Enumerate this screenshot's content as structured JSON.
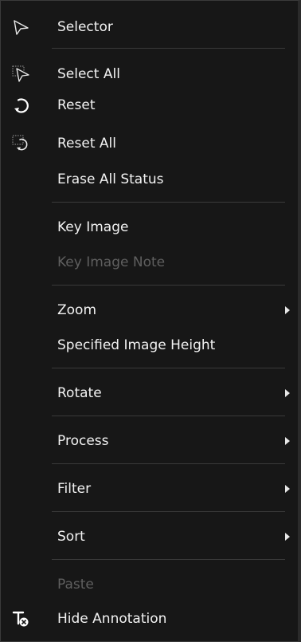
{
  "menu": {
    "items": [
      {
        "label": "Selector",
        "icon": "cursor-arrow-icon",
        "enabled": true,
        "submenu": false
      },
      {
        "label": "Select All",
        "icon": "select-all-icon",
        "enabled": true,
        "submenu": false
      },
      {
        "label": "Reset",
        "icon": "reset-icon",
        "enabled": true,
        "submenu": false
      },
      {
        "label": "Reset All",
        "icon": "reset-all-icon",
        "enabled": true,
        "submenu": false
      },
      {
        "label": "Erase All Status",
        "icon": null,
        "enabled": true,
        "submenu": false
      },
      {
        "label": "Key Image",
        "icon": null,
        "enabled": true,
        "submenu": false
      },
      {
        "label": "Key Image Note",
        "icon": null,
        "enabled": false,
        "submenu": false
      },
      {
        "label": "Zoom",
        "icon": null,
        "enabled": true,
        "submenu": true
      },
      {
        "label": "Specified Image Height",
        "icon": null,
        "enabled": true,
        "submenu": false
      },
      {
        "label": "Rotate",
        "icon": null,
        "enabled": true,
        "submenu": true
      },
      {
        "label": "Process",
        "icon": null,
        "enabled": true,
        "submenu": true
      },
      {
        "label": "Filter",
        "icon": null,
        "enabled": true,
        "submenu": true
      },
      {
        "label": "Sort",
        "icon": null,
        "enabled": true,
        "submenu": true
      },
      {
        "label": "Paste",
        "icon": null,
        "enabled": false,
        "submenu": false
      },
      {
        "label": "Hide Annotation",
        "icon": "hide-annotation-icon",
        "enabled": true,
        "submenu": false
      }
    ]
  },
  "colors": {
    "background": "#171717",
    "text": "#f2f2f2",
    "disabled_text": "#5f5f5f",
    "separator": "#3a3a3a"
  }
}
